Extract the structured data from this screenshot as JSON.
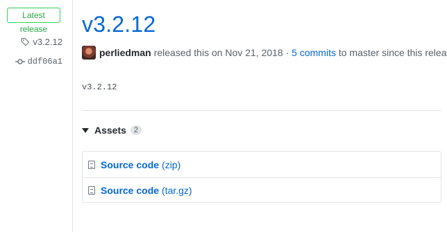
{
  "sidebar": {
    "badge": "Latest release",
    "tag": "v3.2.12",
    "commit": "ddf06a1"
  },
  "release": {
    "title": "v3.2.12",
    "author": "perliedman",
    "released_text": "released this on Nov 21, 2018 ·",
    "commits_link": "5 commits",
    "commits_suffix": "to master since this release",
    "description": "v3.2.12"
  },
  "assets": {
    "label": "Assets",
    "count": "2",
    "items": [
      {
        "name": "Source code",
        "ext": "(zip)"
      },
      {
        "name": "Source code",
        "ext": "(tar.gz)"
      }
    ]
  },
  "colors": {
    "link": "#0366d6",
    "badge_green": "#28a745"
  }
}
